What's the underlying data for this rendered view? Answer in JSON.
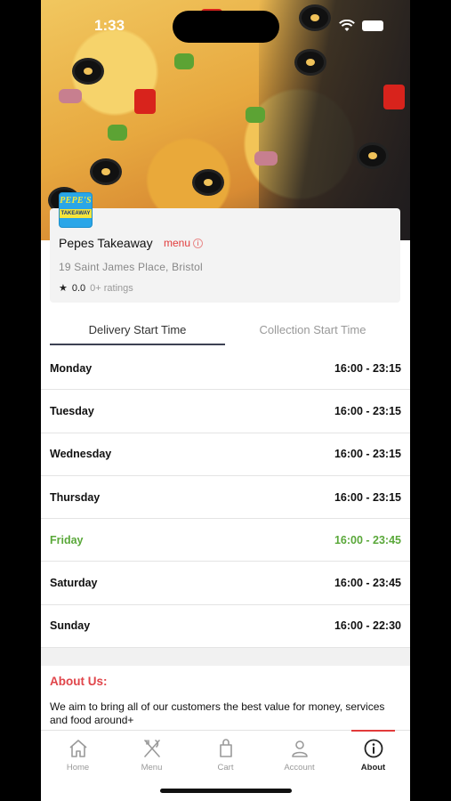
{
  "status_bar": {
    "time": "1:33"
  },
  "store": {
    "logo_text_top": "PEPE'S",
    "logo_text_bottom": "TAKEAWAY",
    "name": "Pepes Takeaway",
    "menu_link": "menu",
    "address": "19 Saint James Place, Bristol",
    "rating": "0.0",
    "rating_count": "0+ ratings"
  },
  "tabs": [
    {
      "label": "Delivery Start Time",
      "active": true
    },
    {
      "label": "Collection Start Time",
      "active": false
    }
  ],
  "schedule": [
    {
      "day": "Monday",
      "hours": "16:00 - 23:15"
    },
    {
      "day": "Tuesday",
      "hours": "16:00 - 23:15"
    },
    {
      "day": "Wednesday",
      "hours": "16:00 - 23:15"
    },
    {
      "day": "Thursday",
      "hours": "16:00 - 23:15"
    },
    {
      "day": "Friday",
      "hours": "16:00 - 23:45",
      "today": true
    },
    {
      "day": "Saturday",
      "hours": "16:00 - 23:45"
    },
    {
      "day": "Sunday",
      "hours": "16:00 - 22:30"
    }
  ],
  "about": {
    "title": "About Us:",
    "text": "We aim to bring all of our customers the best value for money, services and food around+"
  },
  "nav": [
    {
      "label": "Home",
      "icon": "home-icon"
    },
    {
      "label": "Menu",
      "icon": "fork-knife-icon"
    },
    {
      "label": "Cart",
      "icon": "shopping-bag-icon"
    },
    {
      "label": "Account",
      "icon": "user-icon"
    },
    {
      "label": "About",
      "icon": "info-icon",
      "active": true
    }
  ],
  "colors": {
    "accent": "#e23b3b",
    "today": "#5aa83a",
    "tab_underline": "#3d4153"
  }
}
